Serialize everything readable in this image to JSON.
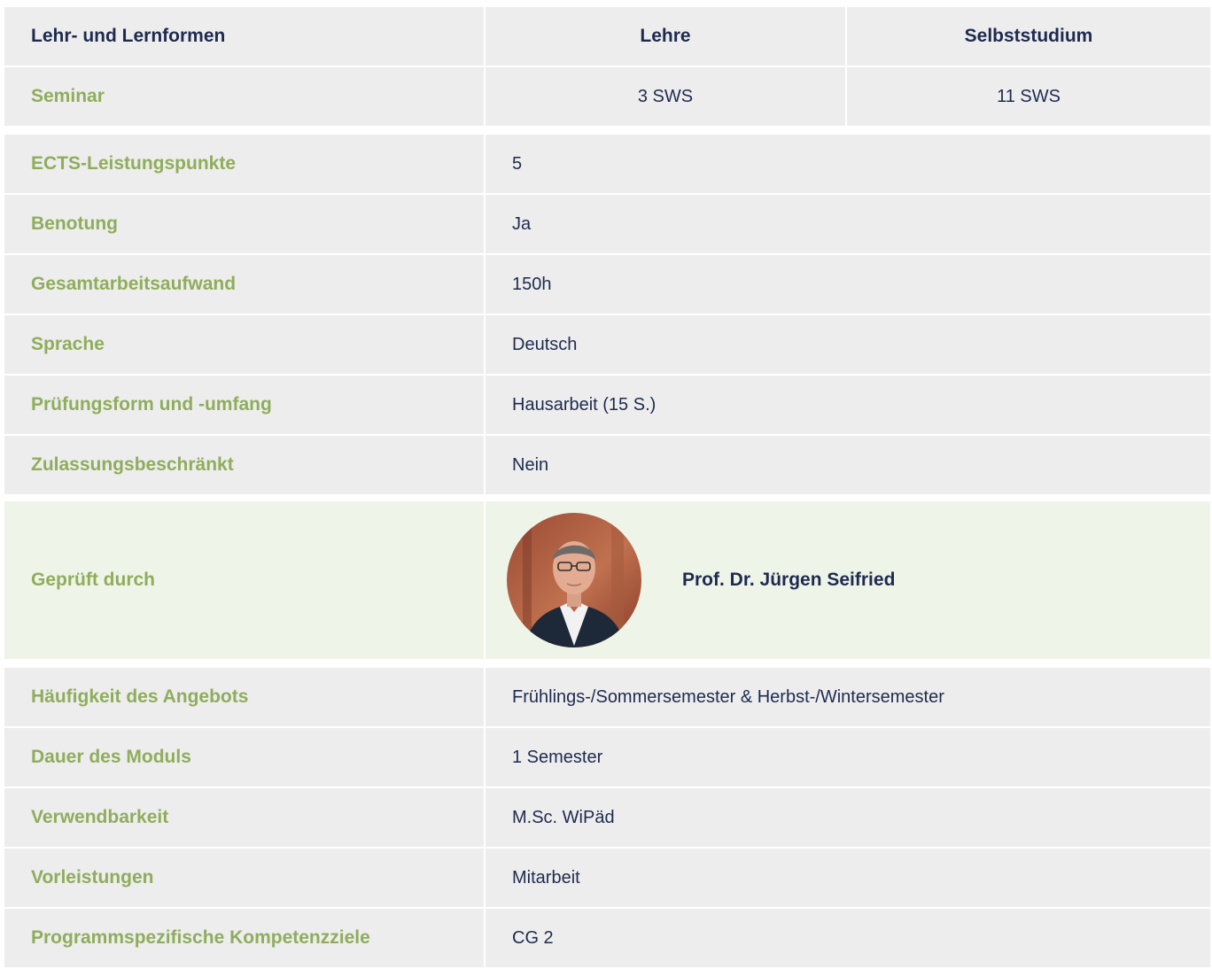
{
  "top_table": {
    "headers": [
      "Lehr- und Lernformen",
      "Lehre",
      "Selbststudium"
    ],
    "row": {
      "label": "Seminar",
      "lehre": "3 SWS",
      "selbststudium": "11 SWS"
    }
  },
  "info_rows": [
    {
      "label": "ECTS-Leistungspunkte",
      "value": "5"
    },
    {
      "label": "Benotung",
      "value": "Ja"
    },
    {
      "label": "Gesamtarbeitsaufwand",
      "value": "150h"
    },
    {
      "label": "Sprache",
      "value": "Deutsch"
    },
    {
      "label": "Prüfungsform und -umfang",
      "value": "Hausarbeit (15 S.)"
    },
    {
      "label": "Zulassungsbeschränkt",
      "value": "Nein"
    }
  ],
  "examiner": {
    "label": "Geprüft durch",
    "name": "Prof. Dr. Jürgen Seifried",
    "photo_icon": "portrait-photo"
  },
  "info_rows_2": [
    {
      "label": "Häufigkeit des Angebots",
      "value": "Frühlings-/Sommersemester & Herbst-/Wintersemester"
    },
    {
      "label": "Dauer des Moduls",
      "value": "1 Semester"
    },
    {
      "label": "Verwendbarkeit",
      "value": "M.Sc. WiPäd"
    },
    {
      "label": "Vorleistungen",
      "value": "Mitarbeit"
    },
    {
      "label": "Programmspezifische Kompetenzziele",
      "value": "CG 2"
    }
  ],
  "colors": {
    "navy": "#1e2b4f",
    "green": "#8fad5c",
    "row_bg": "#ededed",
    "examiner_bg": "#eff4e8"
  }
}
